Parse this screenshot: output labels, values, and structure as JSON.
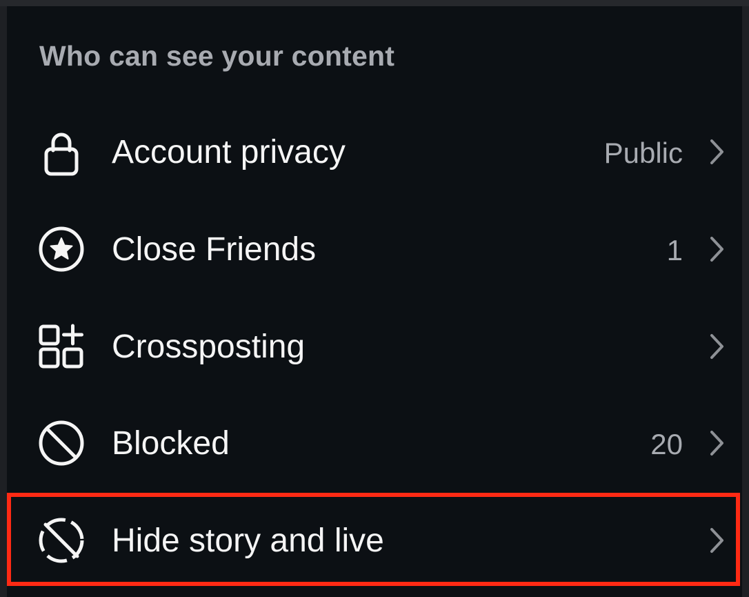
{
  "section": {
    "title": "Who can see your content"
  },
  "items": [
    {
      "label": "Account privacy",
      "value": "Public",
      "icon": "lock-icon"
    },
    {
      "label": "Close Friends",
      "value": "1",
      "icon": "star-circle-icon"
    },
    {
      "label": "Crossposting",
      "value": "",
      "icon": "apps-add-icon"
    },
    {
      "label": "Blocked",
      "value": "20",
      "icon": "blocked-icon"
    },
    {
      "label": "Hide story and live",
      "value": "",
      "icon": "hide-story-icon"
    }
  ],
  "colors": {
    "background": "#0c1014",
    "text": "#f5f5f5",
    "secondary_text": "#a8abb1",
    "highlight": "#ff2a14"
  }
}
